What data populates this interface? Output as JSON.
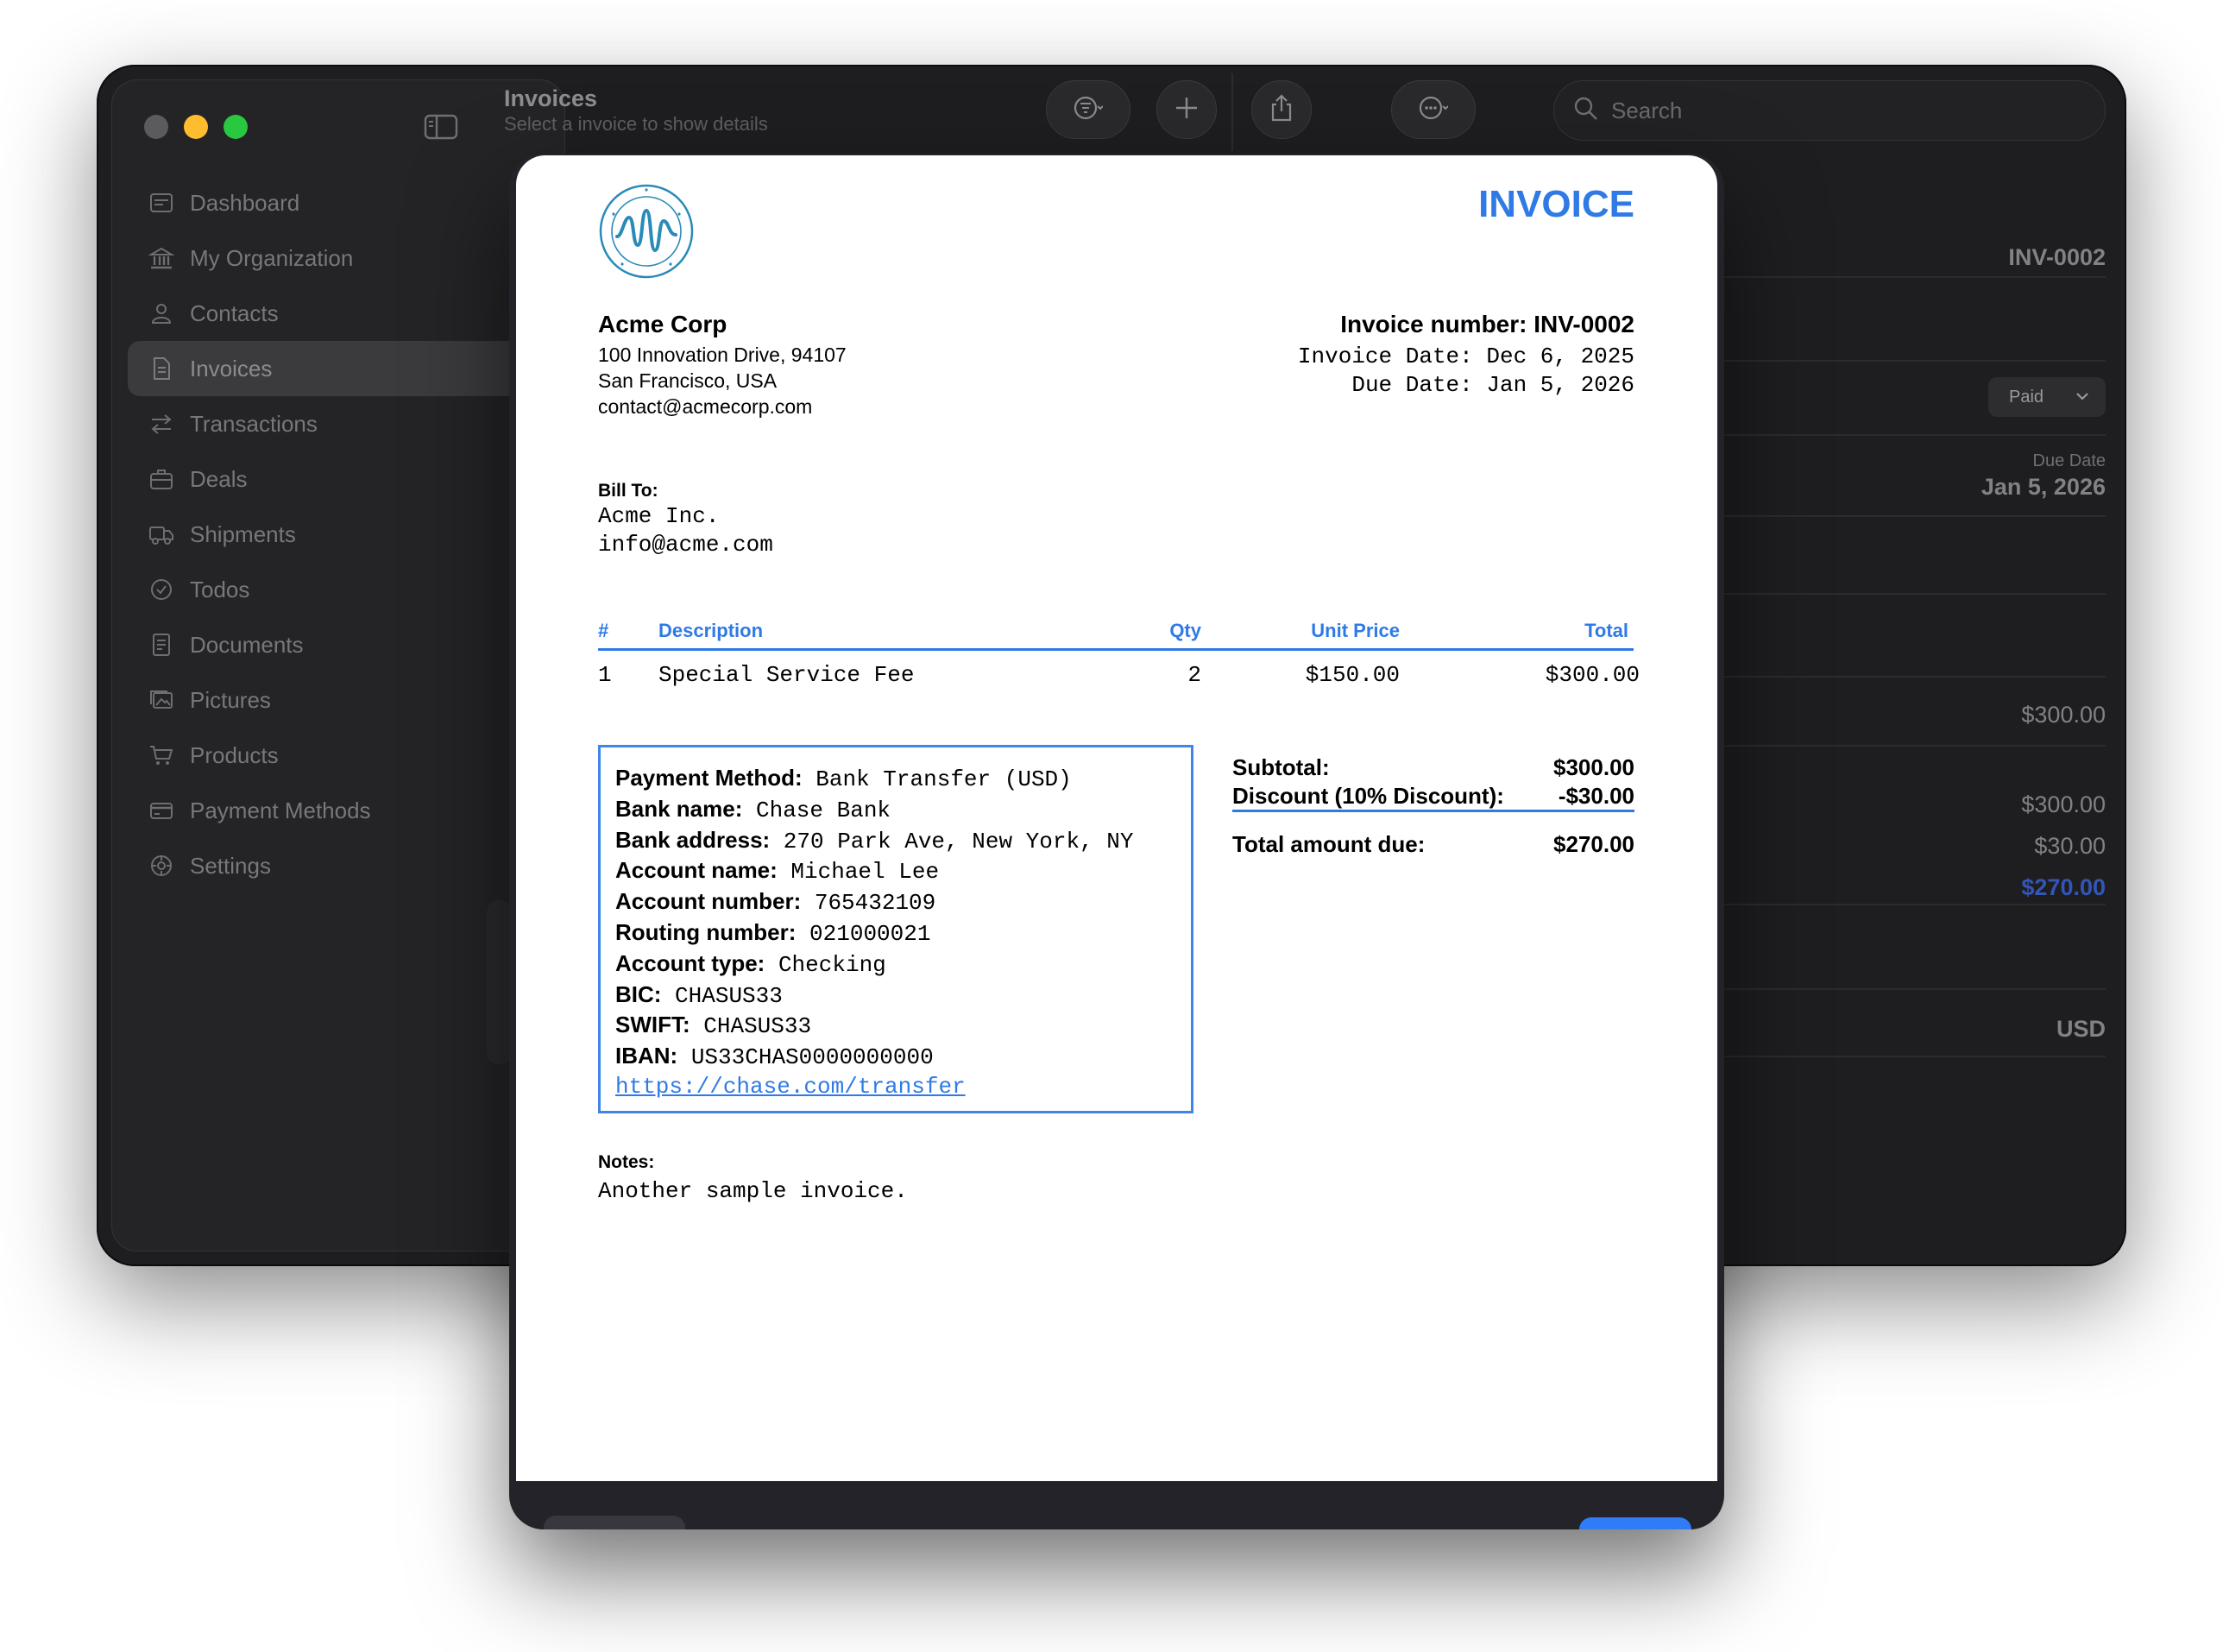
{
  "window": {
    "title": "Invoices",
    "subtitle": "Select a invoice to show details",
    "search_placeholder": "Search"
  },
  "sidebar": {
    "items": [
      {
        "label": "Dashboard",
        "icon": "dashboard-icon"
      },
      {
        "label": "My Organization",
        "icon": "bank-icon"
      },
      {
        "label": "Contacts",
        "icon": "person-icon"
      },
      {
        "label": "Invoices",
        "icon": "document-icon",
        "active": true
      },
      {
        "label": "Transactions",
        "icon": "arrows-icon"
      },
      {
        "label": "Deals",
        "icon": "briefcase-icon"
      },
      {
        "label": "Shipments",
        "icon": "truck-icon"
      },
      {
        "label": "Todos",
        "icon": "checkmark-circle-icon"
      },
      {
        "label": "Documents",
        "icon": "doc-text-icon"
      },
      {
        "label": "Pictures",
        "icon": "photos-icon"
      },
      {
        "label": "Products",
        "icon": "cart-icon"
      },
      {
        "label": "Payment Methods",
        "icon": "credit-card-icon"
      },
      {
        "label": "Settings",
        "icon": "gear-icon"
      }
    ]
  },
  "detail": {
    "invoice_id": "INV-0002",
    "status": "Paid",
    "due_date_label": "Due Date",
    "due_date": "Jan 5, 2026",
    "line_total": "$300.00",
    "subtotal": "$300.00",
    "discount": "$30.00",
    "total": "$270.00",
    "currency": "USD"
  },
  "invoice": {
    "heading": "INVOICE",
    "logo_text": "REDEMBARK MEDICAL DEVICE DISTRIBUTION COMPANY",
    "company": {
      "name": "Acme Corp",
      "address": "100 Innovation Drive, 94107",
      "city": "San Francisco, USA",
      "email": "contact@acmecorp.com"
    },
    "number_line": "Invoice number: INV-0002",
    "date_line": "Invoice Date: Dec 6, 2025",
    "due_line": "Due Date: Jan 5, 2026",
    "bill_to_label": "Bill To:",
    "bill_to": {
      "name": "Acme Inc.",
      "email": "info@acme.com"
    },
    "columns": {
      "num": "#",
      "description": "Description",
      "qty": "Qty",
      "unit_price": "Unit Price",
      "total": "Total"
    },
    "items": [
      {
        "num": "1",
        "description": "Special Service Fee",
        "qty": "2",
        "unit_price": "$150.00",
        "total": "$300.00"
      }
    ],
    "payment": [
      {
        "label": "Payment Method:",
        "value": "Bank Transfer (USD)"
      },
      {
        "label": "Bank name:",
        "value": "Chase Bank"
      },
      {
        "label": "Bank address:",
        "value": "270 Park Ave, New York, NY"
      },
      {
        "label": "Account name:",
        "value": "Michael Lee"
      },
      {
        "label": "Account number:",
        "value": "765432109"
      },
      {
        "label": "Routing number:",
        "value": "021000021"
      },
      {
        "label": "Account type:",
        "value": "Checking"
      },
      {
        "label": "BIC:",
        "value": "CHASUS33"
      },
      {
        "label": "SWIFT:",
        "value": "CHASUS33"
      },
      {
        "label": "IBAN:",
        "value": "US33CHAS0000000000"
      }
    ],
    "payment_link": "https://chase.com/transfer",
    "summary": {
      "subtotal_label": "Subtotal:",
      "subtotal": "$300.00",
      "discount_label": "Discount (10% Discount):",
      "discount": "-$30.00",
      "total_label": "Total amount due:",
      "total": "$270.00"
    },
    "notes_label": "Notes:",
    "notes": "Another sample invoice."
  },
  "colors": {
    "accent": "#2f7ae5",
    "window_bg": "#1e1e20",
    "sidebar_bg": "#242426",
    "traffic_yellow": "#febc2e",
    "traffic_green": "#28c840"
  }
}
